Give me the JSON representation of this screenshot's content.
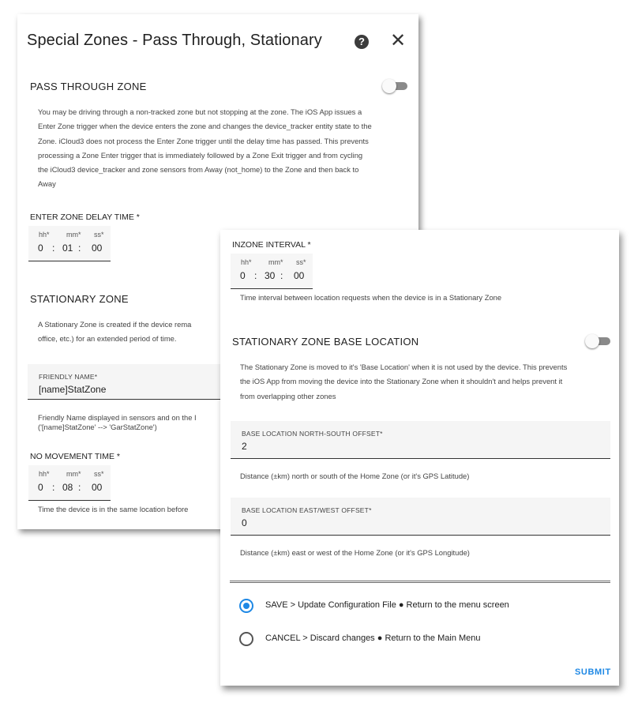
{
  "dialog_back": {
    "title": "Special Zones - Pass Through, Stationary",
    "help_icon": "?",
    "close_icon": "✕",
    "pass_through": {
      "title": "PASS THROUGH ZONE",
      "toggle_on": false,
      "description": [
        "You may be driving through a non-tracked zone but not stopping at the zone. The iOS App issues a",
        "Enter Zone trigger when the device enters the zone and changes the device_tracker entity state to the",
        "Zone. iCloud3 does not process the Enter Zone trigger until the delay time has passed. This prevents",
        "processing a Zone Enter trigger that is immediately followed by a Zone Exit trigger and from cycling",
        "the iCloud3 device_tracker and zone sensors from Away (not_home) to the Zone and then back to",
        "Away"
      ]
    },
    "enter_zone_delay": {
      "label": "ENTER ZONE DELAY TIME *",
      "hh_label": "hh*",
      "mm_label": "mm*",
      "ss_label": "ss*",
      "hh": "0",
      "mm": "01",
      "ss": "00"
    },
    "stationary": {
      "title": "STATIONARY ZONE",
      "description": [
        "A Stationary Zone is created if the device rema",
        "office, etc.) for an extended period of time."
      ]
    },
    "friendly_name": {
      "label": "FRIENDLY NAME*",
      "value": "[name]StatZone",
      "help": [
        "Friendly Name displayed in sensors and on the I",
        "('[name]StatZone' --> 'GarStatZone')"
      ]
    },
    "no_movement": {
      "label": "NO MOVEMENT TIME *",
      "hh_label": "hh*",
      "mm_label": "mm*",
      "ss_label": "ss*",
      "hh": "0",
      "mm": "08",
      "ss": "00",
      "help": "Time the device is in the same location before"
    }
  },
  "dialog_front": {
    "inzone_interval": {
      "label": "INZONE INTERVAL *",
      "hh_label": "hh*",
      "mm_label": "mm*",
      "ss_label": "ss*",
      "hh": "0",
      "mm": "30",
      "ss": "00",
      "help": "Time interval between location requests when the device is in a Stationary Zone"
    },
    "base_location": {
      "title": "STATIONARY ZONE BASE LOCATION",
      "toggle_on": false,
      "description": [
        "The Stationary Zone is moved to it's 'Base Location' when it is not used by the device. This prevents",
        "the iOS App from moving the device into the Stationary Zone when it shouldn't and helps prevent it",
        "from overlapping other zones"
      ]
    },
    "north_south": {
      "label": "BASE LOCATION NORTH-SOUTH OFFSET*",
      "value": "2",
      "help": "Distance (±km) north or south of the Home Zone (or it's GPS Latitude)"
    },
    "east_west": {
      "label": "BASE LOCATION EAST/WEST OFFSET*",
      "value": "0",
      "help": "Distance (±km) east or west of the Home Zone (or it's GPS Longitude)"
    },
    "actions": {
      "save_label": "SAVE > Update Configuration File ● Return to the menu screen",
      "cancel_label": "CANCEL > Discard changes ● Return to the Main Menu",
      "selected": "save"
    },
    "submit_label": "SUBMIT"
  },
  "colors": {
    "accent": "#1e88e5",
    "toggle_track": "#8a8a8a",
    "field_bg": "#f5f5f5"
  }
}
